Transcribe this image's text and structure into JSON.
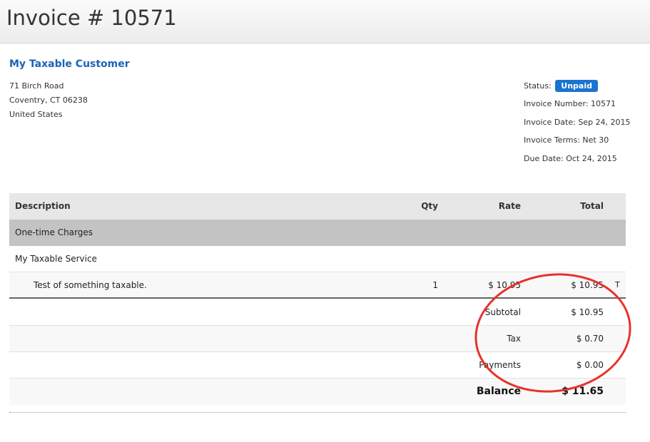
{
  "header": {
    "title": "Invoice # 10571"
  },
  "customer": {
    "name": "My Taxable Customer",
    "address_line1": "71 Birch Road",
    "address_line2": "Coventry, CT 06238",
    "country": "United States"
  },
  "meta": {
    "status_label": "Status:",
    "status_value": "Unpaid",
    "status_color": "#1a73cf",
    "invoice_number": "Invoice Number: 10571",
    "invoice_date": "Invoice Date: Sep 24, 2015",
    "invoice_terms": "Invoice Terms: Net 30",
    "due_date": "Due Date: Oct 24, 2015"
  },
  "table": {
    "columns": {
      "description": "Description",
      "qty": "Qty",
      "rate": "Rate",
      "total": "Total"
    },
    "group_label": "One-time Charges",
    "service_name": "My Taxable Service",
    "line_items": [
      {
        "description": "Test of something taxable.",
        "qty": "1",
        "rate": "$ 10.95",
        "total": "$ 10.95",
        "flag": "T"
      }
    ],
    "summary": [
      {
        "label": "Subtotal",
        "value": "$ 10.95"
      },
      {
        "label": "Tax",
        "value": "$ 0.70"
      },
      {
        "label": "Payments",
        "value": "$ 0.00"
      },
      {
        "label": "Balance",
        "value": "$ 11.65"
      }
    ]
  },
  "annotation": {
    "shape": "hand-drawn ellipse",
    "color": "#e8322a"
  }
}
